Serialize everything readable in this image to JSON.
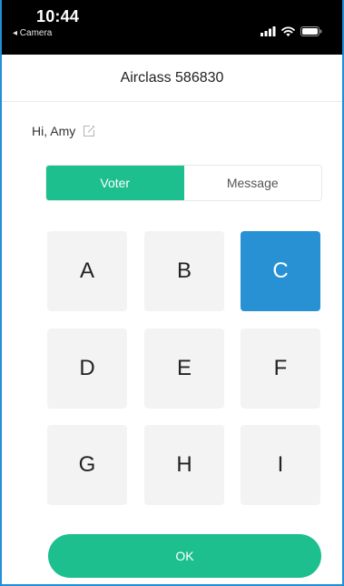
{
  "status_bar": {
    "time": "10:44",
    "back_label": "◂ Camera",
    "icons": [
      "cellular-signal-icon",
      "wifi-icon",
      "battery-icon"
    ]
  },
  "header": {
    "title": "Airclass 586830"
  },
  "greeting": {
    "text": "Hi, Amy",
    "icon": "edit-icon"
  },
  "tabs": [
    {
      "label": "Voter",
      "active": true
    },
    {
      "label": "Message",
      "active": false
    }
  ],
  "options": [
    {
      "label": "A",
      "selected": false
    },
    {
      "label": "B",
      "selected": false
    },
    {
      "label": "C",
      "selected": true
    },
    {
      "label": "D",
      "selected": false
    },
    {
      "label": "E",
      "selected": false
    },
    {
      "label": "F",
      "selected": false
    },
    {
      "label": "G",
      "selected": false
    },
    {
      "label": "H",
      "selected": false
    },
    {
      "label": "I",
      "selected": false
    }
  ],
  "actions": {
    "ok_label": "OK"
  },
  "colors": {
    "accent_green": "#1dbf8f",
    "selected_blue": "#2891d4",
    "frame_blue": "#1f8fd8"
  }
}
